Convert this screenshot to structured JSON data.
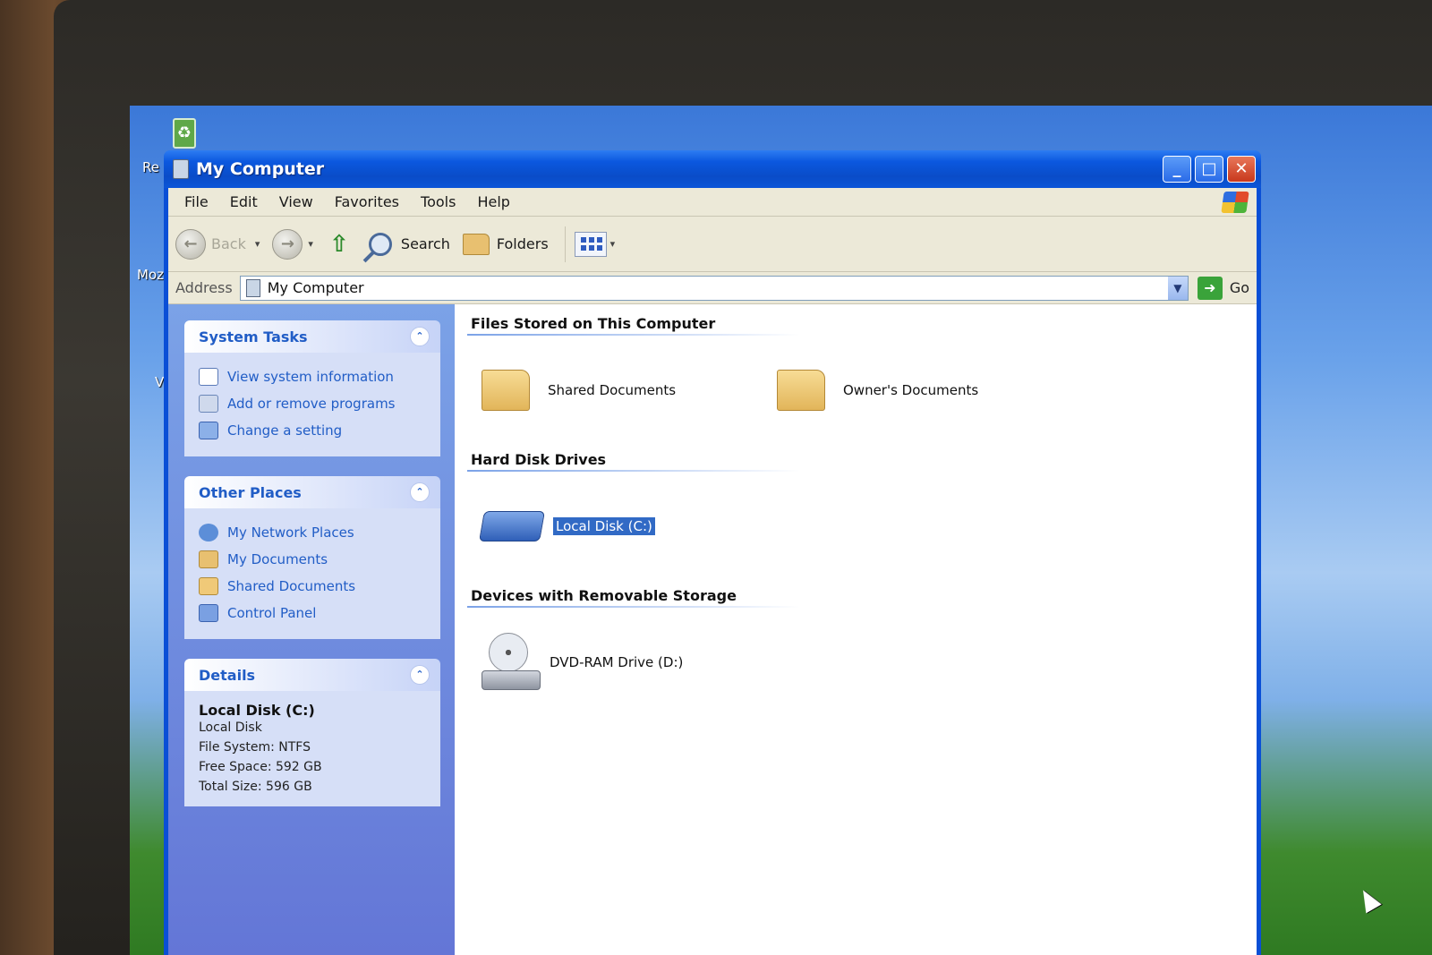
{
  "desktop": {
    "icon_labels": [
      "Re",
      "Moz",
      "Vi"
    ]
  },
  "window": {
    "title": "My Computer",
    "controls": {
      "minimize": "_",
      "maximize": "□",
      "close": "✕"
    }
  },
  "menu": [
    "File",
    "Edit",
    "View",
    "Favorites",
    "Tools",
    "Help"
  ],
  "toolbar": {
    "back_label": "Back",
    "search_label": "Search",
    "folders_label": "Folders"
  },
  "address": {
    "label": "Address",
    "value": "My Computer",
    "go_label": "Go"
  },
  "sidebar": {
    "system_tasks": {
      "title": "System Tasks",
      "items": [
        "View system information",
        "Add or remove programs",
        "Change a setting"
      ]
    },
    "other_places": {
      "title": "Other Places",
      "items": [
        "My Network Places",
        "My Documents",
        "Shared Documents",
        "Control Panel"
      ]
    },
    "details": {
      "title": "Details",
      "name": "Local Disk (C:)",
      "type": "Local Disk",
      "file_system": "File System: NTFS",
      "free_space": "Free Space: 592 GB",
      "total_size": "Total Size: 596 GB"
    }
  },
  "main": {
    "groups": [
      {
        "title": "Files Stored on This Computer",
        "items": [
          "Shared Documents",
          "Owner's Documents"
        ]
      },
      {
        "title": "Hard Disk Drives",
        "items": [
          "Local Disk (C:)"
        ]
      },
      {
        "title": "Devices with Removable Storage",
        "items": [
          "DVD-RAM Drive (D:)"
        ]
      }
    ],
    "selected_item": "Local Disk (C:)"
  },
  "colors": {
    "titlebar": "#0b58df",
    "taskpane": "#7ba2e7",
    "link": "#215dc6",
    "selection": "#316ac5"
  }
}
